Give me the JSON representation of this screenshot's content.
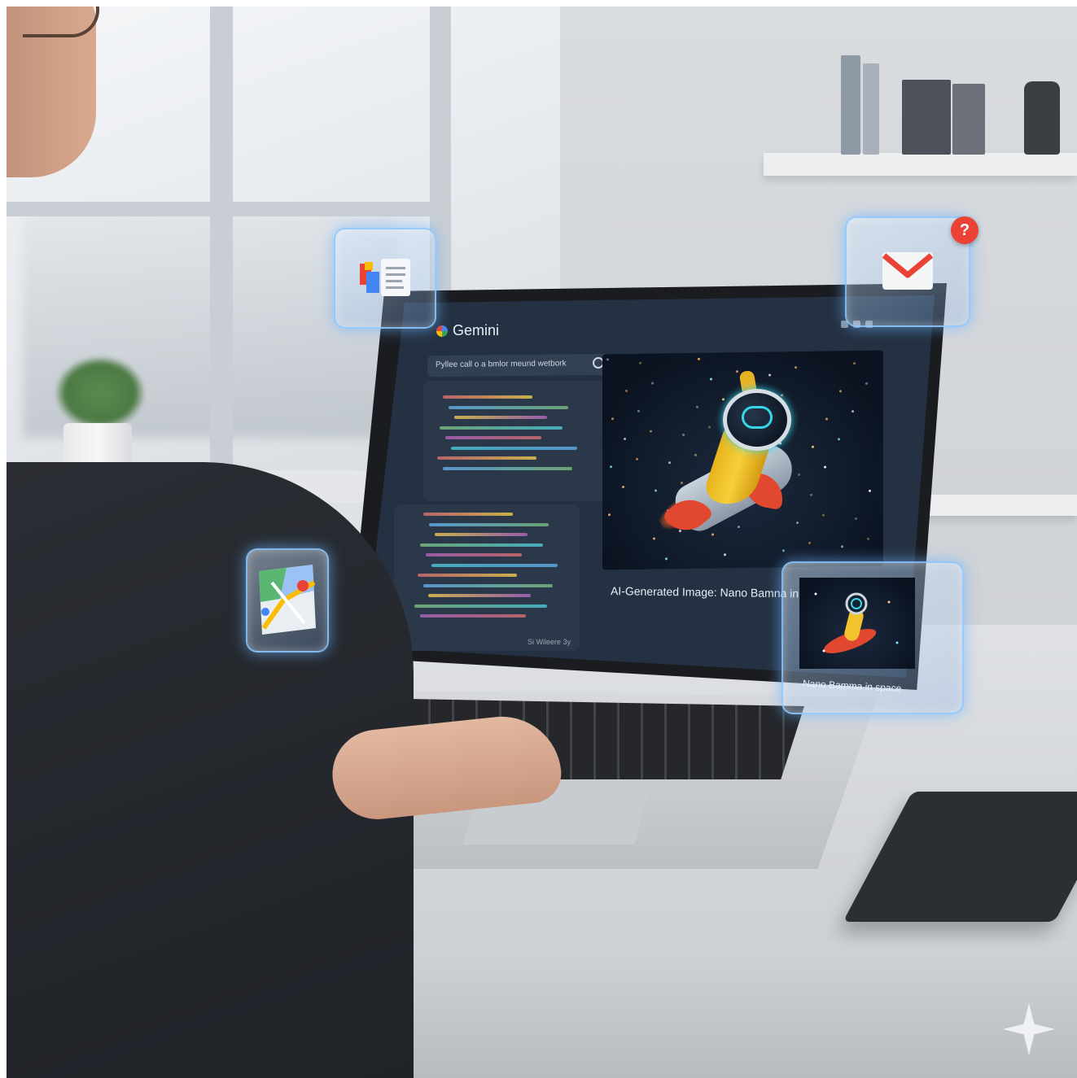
{
  "app": {
    "title": "Gemini",
    "prompt_placeholder": "Pyllee call o a bmlor meund wetbork",
    "footer_note": "Si Wileere 3y"
  },
  "image_panel": {
    "caption": "AI-Generated Image: Nano Bamna in space"
  },
  "floating_cards": {
    "gmail_badge": "?",
    "thumbnail_label": "Nano Bamma in space"
  },
  "colors": {
    "accent_glow": "#6eb4ff",
    "screen_bg": "#243142",
    "badge_red": "#ea4335"
  },
  "icons": [
    "docs-icon",
    "gmail-icon",
    "maps-icon",
    "search-icon",
    "gemini-sparkle-icon"
  ]
}
